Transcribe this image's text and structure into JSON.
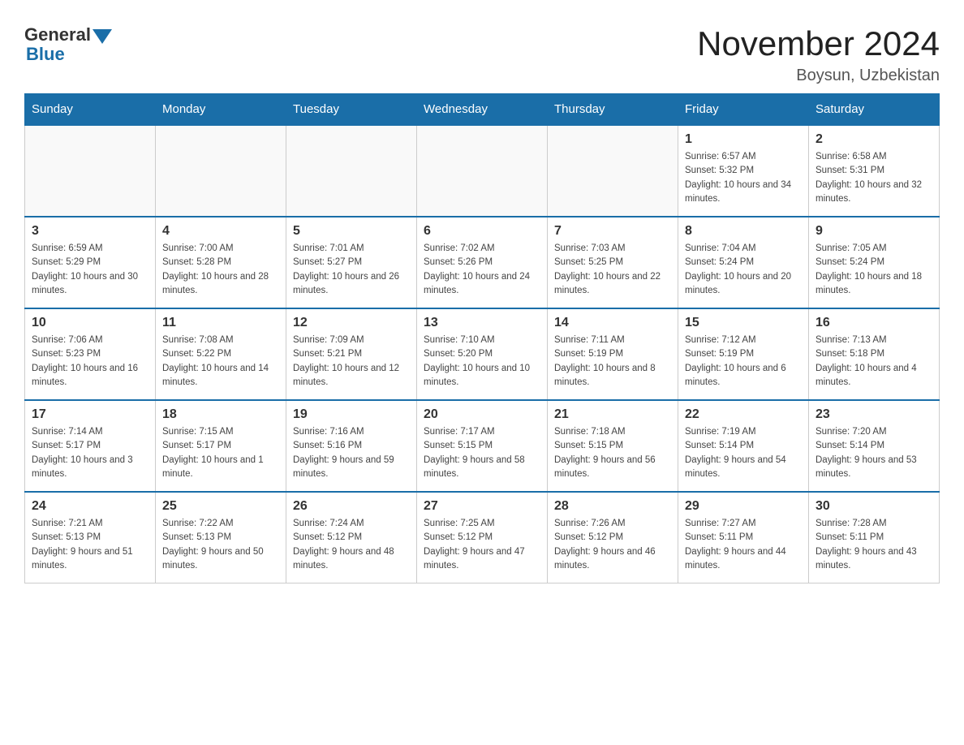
{
  "logo": {
    "general": "General",
    "blue": "Blue"
  },
  "title": "November 2024",
  "location": "Boysun, Uzbekistan",
  "days_of_week": [
    "Sunday",
    "Monday",
    "Tuesday",
    "Wednesday",
    "Thursday",
    "Friday",
    "Saturday"
  ],
  "weeks": [
    [
      {
        "day": "",
        "info": ""
      },
      {
        "day": "",
        "info": ""
      },
      {
        "day": "",
        "info": ""
      },
      {
        "day": "",
        "info": ""
      },
      {
        "day": "",
        "info": ""
      },
      {
        "day": "1",
        "info": "Sunrise: 6:57 AM\nSunset: 5:32 PM\nDaylight: 10 hours and 34 minutes."
      },
      {
        "day": "2",
        "info": "Sunrise: 6:58 AM\nSunset: 5:31 PM\nDaylight: 10 hours and 32 minutes."
      }
    ],
    [
      {
        "day": "3",
        "info": "Sunrise: 6:59 AM\nSunset: 5:29 PM\nDaylight: 10 hours and 30 minutes."
      },
      {
        "day": "4",
        "info": "Sunrise: 7:00 AM\nSunset: 5:28 PM\nDaylight: 10 hours and 28 minutes."
      },
      {
        "day": "5",
        "info": "Sunrise: 7:01 AM\nSunset: 5:27 PM\nDaylight: 10 hours and 26 minutes."
      },
      {
        "day": "6",
        "info": "Sunrise: 7:02 AM\nSunset: 5:26 PM\nDaylight: 10 hours and 24 minutes."
      },
      {
        "day": "7",
        "info": "Sunrise: 7:03 AM\nSunset: 5:25 PM\nDaylight: 10 hours and 22 minutes."
      },
      {
        "day": "8",
        "info": "Sunrise: 7:04 AM\nSunset: 5:24 PM\nDaylight: 10 hours and 20 minutes."
      },
      {
        "day": "9",
        "info": "Sunrise: 7:05 AM\nSunset: 5:24 PM\nDaylight: 10 hours and 18 minutes."
      }
    ],
    [
      {
        "day": "10",
        "info": "Sunrise: 7:06 AM\nSunset: 5:23 PM\nDaylight: 10 hours and 16 minutes."
      },
      {
        "day": "11",
        "info": "Sunrise: 7:08 AM\nSunset: 5:22 PM\nDaylight: 10 hours and 14 minutes."
      },
      {
        "day": "12",
        "info": "Sunrise: 7:09 AM\nSunset: 5:21 PM\nDaylight: 10 hours and 12 minutes."
      },
      {
        "day": "13",
        "info": "Sunrise: 7:10 AM\nSunset: 5:20 PM\nDaylight: 10 hours and 10 minutes."
      },
      {
        "day": "14",
        "info": "Sunrise: 7:11 AM\nSunset: 5:19 PM\nDaylight: 10 hours and 8 minutes."
      },
      {
        "day": "15",
        "info": "Sunrise: 7:12 AM\nSunset: 5:19 PM\nDaylight: 10 hours and 6 minutes."
      },
      {
        "day": "16",
        "info": "Sunrise: 7:13 AM\nSunset: 5:18 PM\nDaylight: 10 hours and 4 minutes."
      }
    ],
    [
      {
        "day": "17",
        "info": "Sunrise: 7:14 AM\nSunset: 5:17 PM\nDaylight: 10 hours and 3 minutes."
      },
      {
        "day": "18",
        "info": "Sunrise: 7:15 AM\nSunset: 5:17 PM\nDaylight: 10 hours and 1 minute."
      },
      {
        "day": "19",
        "info": "Sunrise: 7:16 AM\nSunset: 5:16 PM\nDaylight: 9 hours and 59 minutes."
      },
      {
        "day": "20",
        "info": "Sunrise: 7:17 AM\nSunset: 5:15 PM\nDaylight: 9 hours and 58 minutes."
      },
      {
        "day": "21",
        "info": "Sunrise: 7:18 AM\nSunset: 5:15 PM\nDaylight: 9 hours and 56 minutes."
      },
      {
        "day": "22",
        "info": "Sunrise: 7:19 AM\nSunset: 5:14 PM\nDaylight: 9 hours and 54 minutes."
      },
      {
        "day": "23",
        "info": "Sunrise: 7:20 AM\nSunset: 5:14 PM\nDaylight: 9 hours and 53 minutes."
      }
    ],
    [
      {
        "day": "24",
        "info": "Sunrise: 7:21 AM\nSunset: 5:13 PM\nDaylight: 9 hours and 51 minutes."
      },
      {
        "day": "25",
        "info": "Sunrise: 7:22 AM\nSunset: 5:13 PM\nDaylight: 9 hours and 50 minutes."
      },
      {
        "day": "26",
        "info": "Sunrise: 7:24 AM\nSunset: 5:12 PM\nDaylight: 9 hours and 48 minutes."
      },
      {
        "day": "27",
        "info": "Sunrise: 7:25 AM\nSunset: 5:12 PM\nDaylight: 9 hours and 47 minutes."
      },
      {
        "day": "28",
        "info": "Sunrise: 7:26 AM\nSunset: 5:12 PM\nDaylight: 9 hours and 46 minutes."
      },
      {
        "day": "29",
        "info": "Sunrise: 7:27 AM\nSunset: 5:11 PM\nDaylight: 9 hours and 44 minutes."
      },
      {
        "day": "30",
        "info": "Sunrise: 7:28 AM\nSunset: 5:11 PM\nDaylight: 9 hours and 43 minutes."
      }
    ]
  ]
}
